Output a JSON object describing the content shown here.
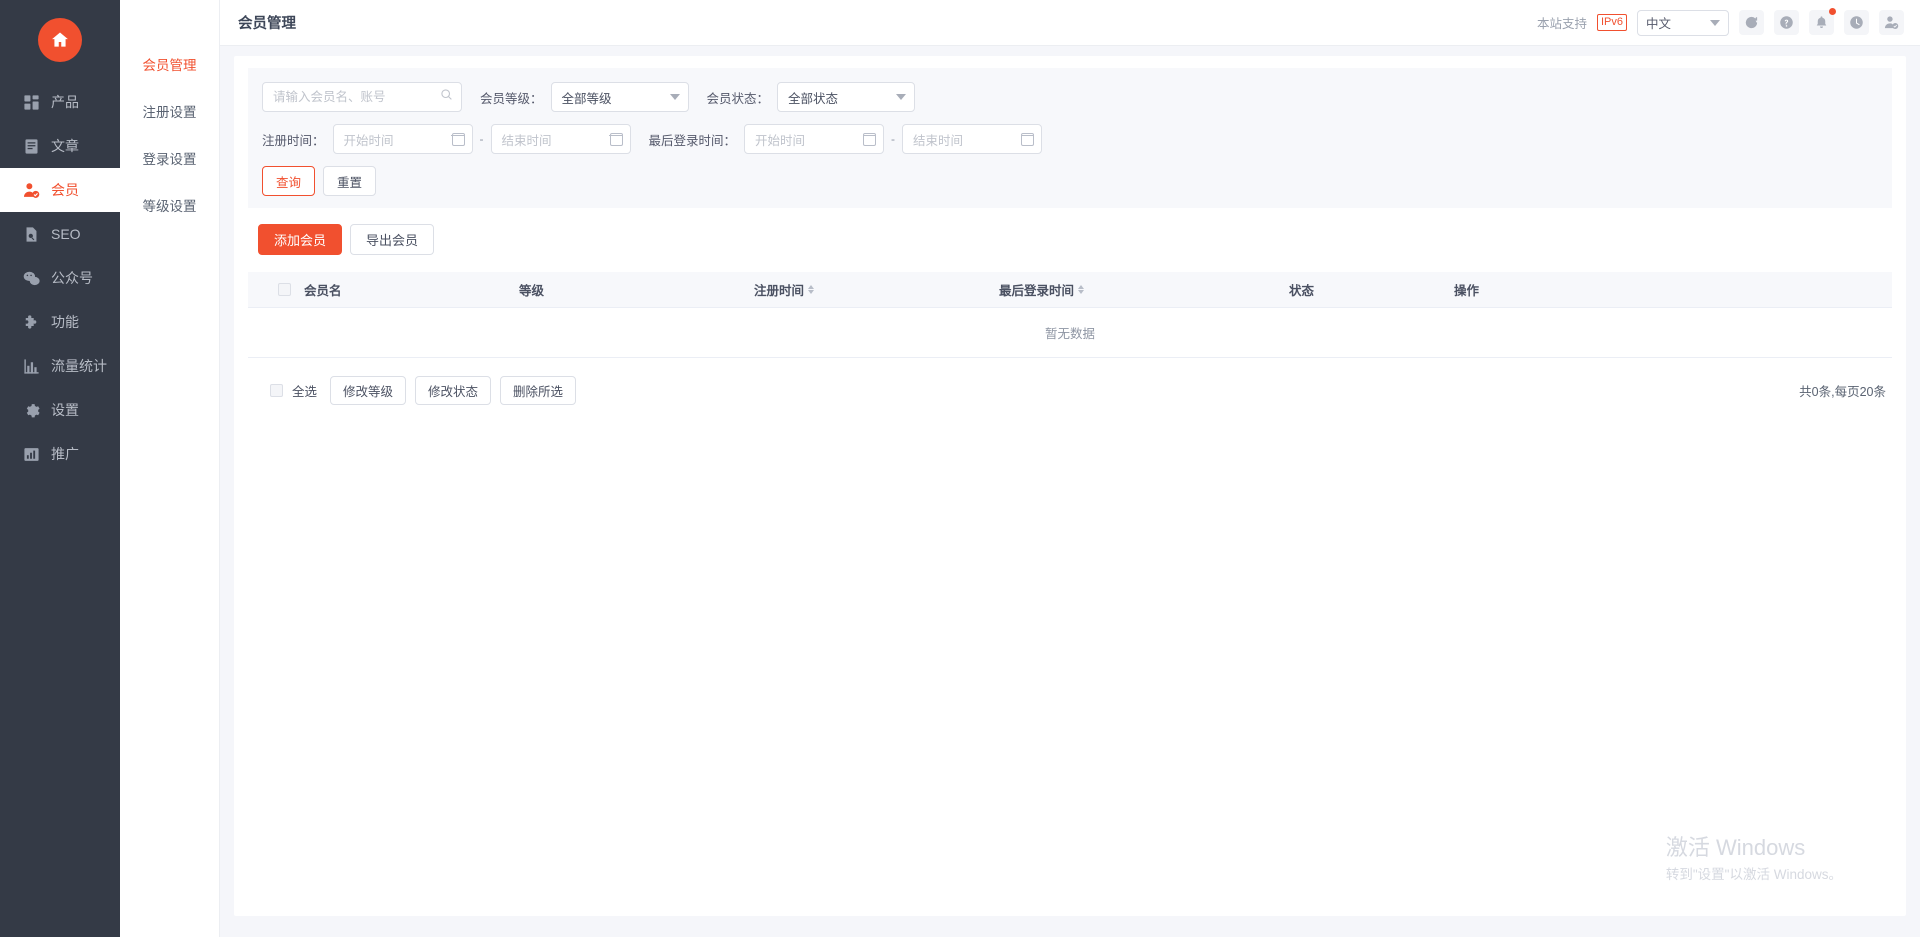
{
  "sidebar": {
    "logo_icon": "home-icon",
    "items": [
      {
        "label": "产品",
        "icon": "grid-icon",
        "active": false
      },
      {
        "label": "文章",
        "icon": "document-icon",
        "active": false
      },
      {
        "label": "会员",
        "icon": "user-check-icon",
        "active": true
      },
      {
        "label": "SEO",
        "icon": "page-search-icon",
        "active": false
      },
      {
        "label": "公众号",
        "icon": "wechat-icon",
        "active": false
      },
      {
        "label": "功能",
        "icon": "puzzle-icon",
        "active": false
      },
      {
        "label": "流量统计",
        "icon": "bar-chart-icon",
        "active": false
      },
      {
        "label": "设置",
        "icon": "gear-icon",
        "active": false
      },
      {
        "label": "推广",
        "icon": "trend-chart-icon",
        "active": false
      }
    ]
  },
  "subnav": {
    "items": [
      {
        "label": "会员管理",
        "active": true
      },
      {
        "label": "注册设置",
        "active": false
      },
      {
        "label": "登录设置",
        "active": false
      },
      {
        "label": "等级设置",
        "active": false
      }
    ]
  },
  "topbar": {
    "title": "会员管理",
    "support_text": "本站支持",
    "ipv6_badge": "IPv6",
    "language": "中文",
    "icons": [
      {
        "name": "refresh-icon",
        "badge": false
      },
      {
        "name": "help-icon",
        "badge": false
      },
      {
        "name": "notification-icon",
        "badge": true
      },
      {
        "name": "clock-icon",
        "badge": false
      },
      {
        "name": "user-account-icon",
        "badge": false
      }
    ]
  },
  "filters": {
    "search_placeholder": "请输入会员名、账号",
    "search_value": "",
    "level_label": "会员等级：",
    "level_value": "全部等级",
    "status_label": "会员状态：",
    "status_value": "全部状态",
    "register_time_label": "注册时间：",
    "register_start_placeholder": "开始时间",
    "register_end_placeholder": "结束时间",
    "last_login_label": "最后登录时间：",
    "login_start_placeholder": "开始时间",
    "login_end_placeholder": "结束时间",
    "range_separator": "-",
    "query_button": "查询",
    "reset_button": "重置"
  },
  "actions": {
    "add_member": "添加会员",
    "export_member": "导出会员"
  },
  "table": {
    "columns": [
      {
        "label": "会员名",
        "sortable": false
      },
      {
        "label": "等级",
        "sortable": false
      },
      {
        "label": "注册时间",
        "sortable": true
      },
      {
        "label": "最后登录时间",
        "sortable": true
      },
      {
        "label": "状态",
        "sortable": false
      },
      {
        "label": "操作",
        "sortable": false
      }
    ],
    "rows": [],
    "empty_text": "暂无数据"
  },
  "bulk": {
    "select_all": "全选",
    "change_level": "修改等级",
    "change_status": "修改状态",
    "delete_selected": "删除所选",
    "page_info": "共0条,每页20条"
  },
  "watermark": {
    "title": "激活 Windows",
    "subtitle": "转到\"设置\"以激活 Windows。"
  },
  "colors": {
    "brand": "#f1502f",
    "sidebar_bg": "#343a46",
    "content_bg": "#f5f6fa",
    "panel_bg": "#f7f8fb"
  }
}
